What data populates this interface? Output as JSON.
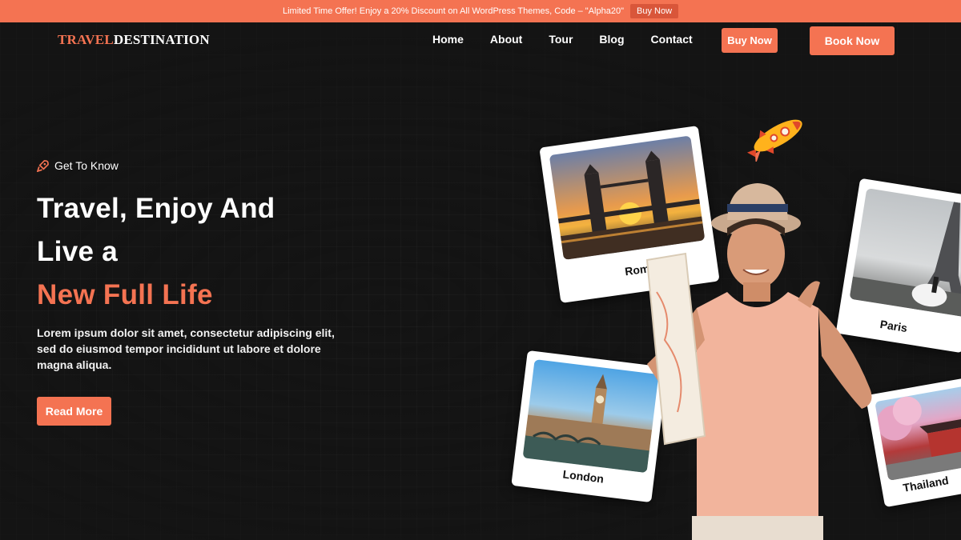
{
  "promo": {
    "text": "Limited Time Offer! Enjoy a 20% Discount on All WordPress Themes, Code – \"Alpha20\"",
    "button": "Buy Now"
  },
  "logo": {
    "part1": "TRAVEL",
    "part2": "DESTINATION"
  },
  "nav": {
    "items": [
      "Home",
      "About",
      "Tour",
      "Blog",
      "Contact"
    ],
    "buy_now": "Buy Now",
    "book_now": "Book Now"
  },
  "hero": {
    "eyebrow_icon": "rocket-icon",
    "eyebrow": "Get To Know",
    "title_line1": "Travel, Enjoy And",
    "title_line2": "Live a",
    "title_accent": "New Full Life",
    "description": "Lorem ipsum dolor sit amet, consectetur adipiscing elit, sed do eiusmod tempor incididunt ut labore et dolore magna aliqua.",
    "cta": "Read More"
  },
  "polaroids": [
    {
      "caption": "Rom"
    },
    {
      "caption": "Paris"
    },
    {
      "caption": "London"
    },
    {
      "caption": "Thailand"
    }
  ],
  "colors": {
    "accent": "#f47352",
    "background": "#141414"
  }
}
